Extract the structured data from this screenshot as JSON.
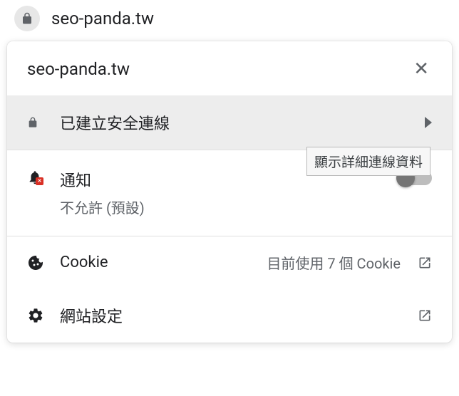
{
  "address_bar": {
    "url": "seo-panda.tw"
  },
  "popup": {
    "title": "seo-panda.tw",
    "connection": {
      "label": "已建立安全連線",
      "tooltip": "顯示詳細連線資料"
    },
    "notifications": {
      "title": "通知",
      "status": "不允許 (預設)"
    },
    "cookie": {
      "label": "Cookie",
      "detail": "目前使用 7 個 Cookie"
    },
    "site_settings": {
      "label": "網站設定"
    }
  }
}
